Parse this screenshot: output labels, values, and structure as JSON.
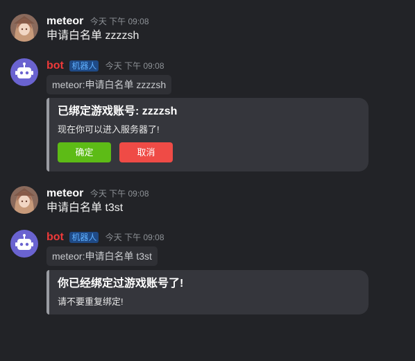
{
  "messages": [
    {
      "author": "meteor",
      "time": "今天 下午 09:08",
      "text": "申请白名单 zzzzsh"
    },
    {
      "author": "bot",
      "badge": "机器人",
      "time": "今天 下午 09:08",
      "command": "meteor:申请白名单 zzzzsh",
      "embed": {
        "title": "已绑定游戏账号: zzzzsh",
        "description": "现在你可以进入服务器了!",
        "confirm_label": "确定",
        "cancel_label": "取消"
      }
    },
    {
      "author": "meteor",
      "time": "今天 下午 09:08",
      "text": "申请白名单 t3st"
    },
    {
      "author": "bot",
      "badge": "机器人",
      "time": "今天 下午 09:08",
      "command": "meteor:申请白名单 t3st",
      "embed": {
        "title": "你已经绑定过游戏账号了!",
        "description": "请不要重复绑定!"
      }
    }
  ],
  "colors": {
    "background": "#222327",
    "user_name": "#ffffff",
    "bot_name": "#ef3a3a",
    "badge_bg": "#1f4a86",
    "badge_text": "#5fb0ff",
    "embed_bg": "#35363c",
    "embed_border": "#9a9ca2",
    "confirm_button": "#5dbb16",
    "cancel_button": "#ef4b46",
    "bot_avatar": "#6a63d0"
  },
  "icons": {
    "user_avatar": "anime-girl-avatar",
    "bot_avatar": "robot-icon"
  }
}
